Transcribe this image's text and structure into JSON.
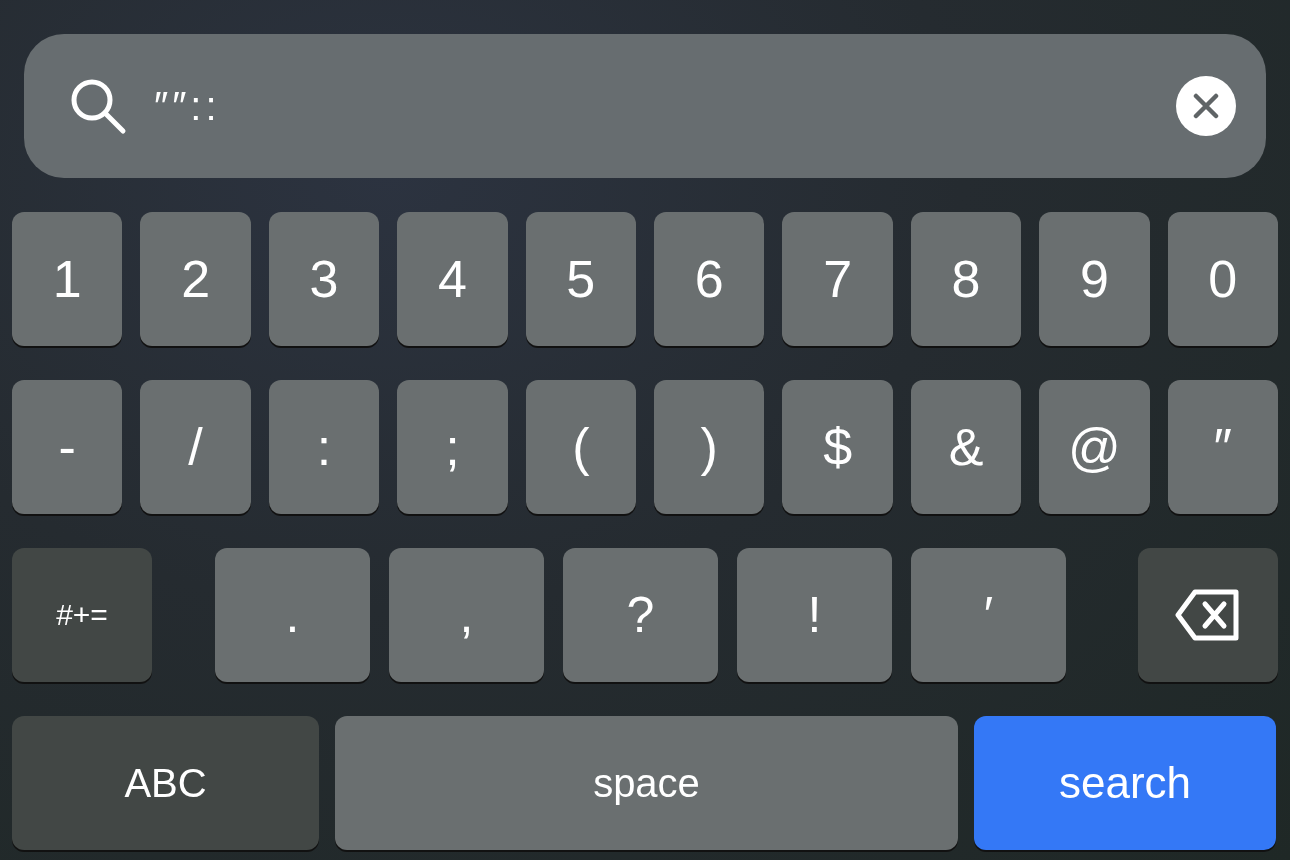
{
  "search_field": {
    "value": "″″::"
  },
  "rows": [
    [
      {
        "kind": "char",
        "label": "1"
      },
      {
        "kind": "char",
        "label": "2"
      },
      {
        "kind": "char",
        "label": "3"
      },
      {
        "kind": "char",
        "label": "4"
      },
      {
        "kind": "char",
        "label": "5"
      },
      {
        "kind": "char",
        "label": "6"
      },
      {
        "kind": "char",
        "label": "7"
      },
      {
        "kind": "char",
        "label": "8"
      },
      {
        "kind": "char",
        "label": "9"
      },
      {
        "kind": "char",
        "label": "0"
      }
    ],
    [
      {
        "kind": "char",
        "label": "-"
      },
      {
        "kind": "char",
        "label": "/"
      },
      {
        "kind": "char",
        "label": ":"
      },
      {
        "kind": "char",
        "label": ";"
      },
      {
        "kind": "char",
        "label": "("
      },
      {
        "kind": "char",
        "label": ")"
      },
      {
        "kind": "char",
        "label": "$"
      },
      {
        "kind": "char",
        "label": "&"
      },
      {
        "kind": "char",
        "label": "@"
      },
      {
        "kind": "char",
        "label": "″"
      }
    ],
    [
      {
        "kind": "mode",
        "label": "#+="
      },
      {
        "kind": "punct",
        "label": "."
      },
      {
        "kind": "punct",
        "label": ","
      },
      {
        "kind": "punct",
        "label": "?"
      },
      {
        "kind": "punct",
        "label": "!"
      },
      {
        "kind": "punct",
        "label": "′"
      },
      {
        "kind": "delete"
      }
    ],
    [
      {
        "kind": "abc",
        "label": "ABC"
      },
      {
        "kind": "space",
        "label": "space"
      },
      {
        "kind": "action",
        "label": "search"
      }
    ]
  ]
}
